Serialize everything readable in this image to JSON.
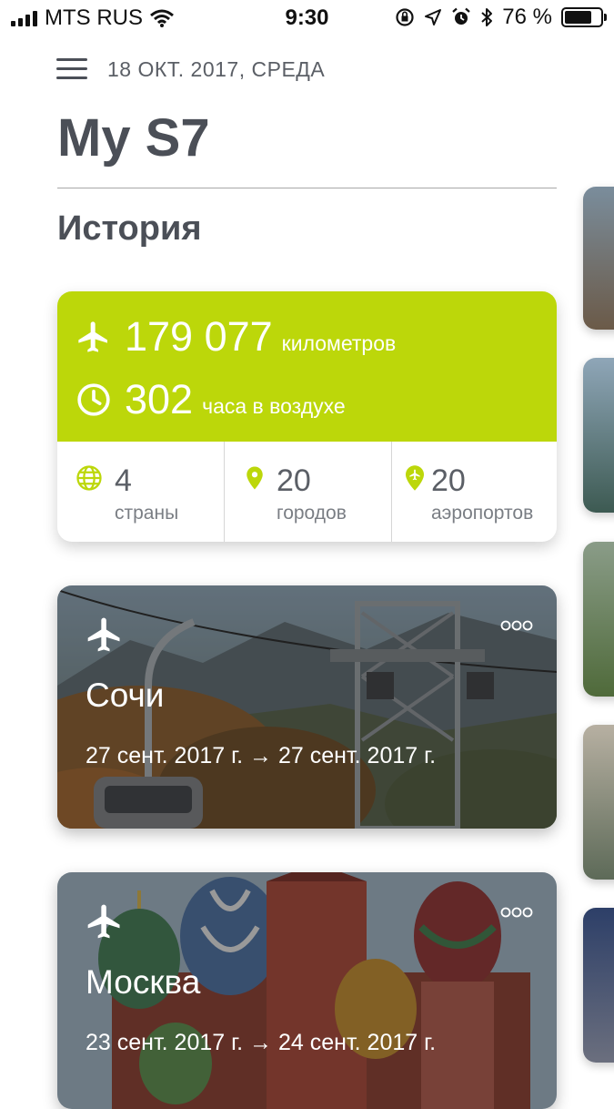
{
  "status_bar": {
    "carrier": "MTS RUS",
    "time": "9:30",
    "battery_text": "76 %",
    "battery_level": 0.76
  },
  "header": {
    "date": "18 ОКТ. 2017, СРЕДА",
    "title": "My S7",
    "section_title": "История"
  },
  "stats": {
    "distance_value": "179 077",
    "distance_unit": "километров",
    "hours_value": "302",
    "hours_unit": "часа в воздухе",
    "countries_value": "4",
    "countries_label": "страны",
    "cities_value": "20",
    "cities_label": "городов",
    "airports_value": "20",
    "airports_label": "аэропортов",
    "accent_color": "#bcd70a"
  },
  "trips": [
    {
      "city": "Сочи",
      "dates": "27 сент. 2017 г. → 27 сент. 2017 г."
    },
    {
      "city": "Москва",
      "dates": "23 сент. 2017 г. → 24 сент. 2017 г."
    }
  ],
  "icons": {
    "menu": "hamburger-icon",
    "plane": "airplane-icon",
    "clock": "clock-icon",
    "globe": "globe-icon",
    "pin": "location-pin-icon",
    "airport": "airport-pin-icon",
    "more": "more-dots-icon"
  }
}
